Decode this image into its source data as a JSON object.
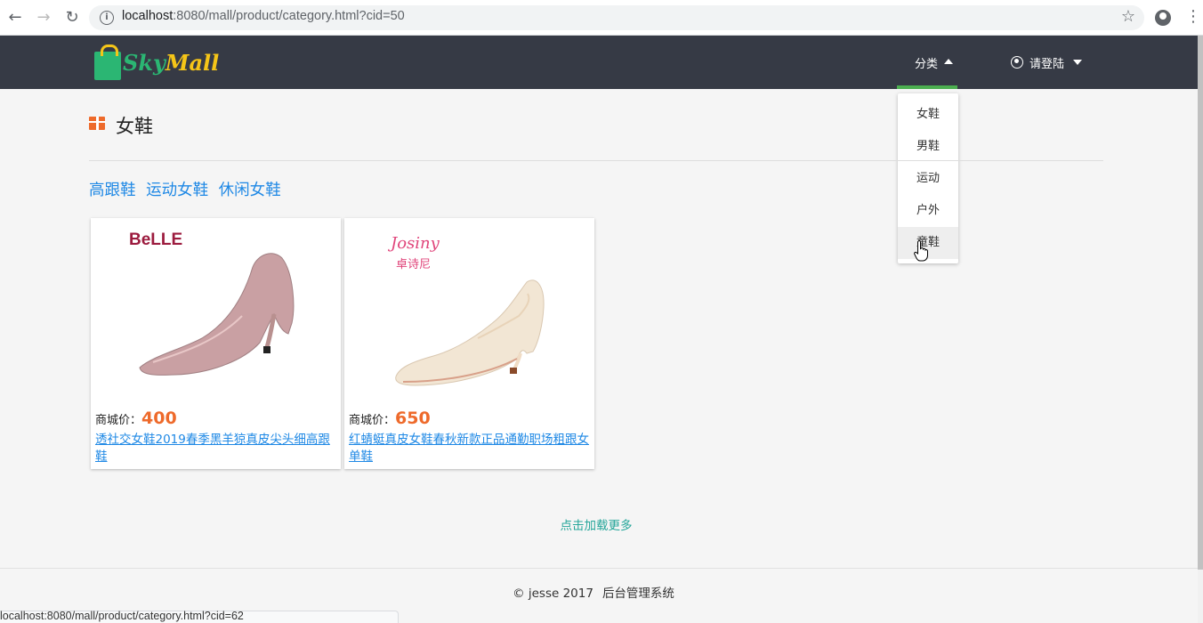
{
  "browser": {
    "url_host": "localhost",
    "url_rest": ":8080/mall/product/category.html?cid=50",
    "status_url": "localhost:8080/mall/product/category.html?cid=62"
  },
  "navbar": {
    "logo_sky": "Sky",
    "logo_mall": "Mall",
    "category_label": "分类",
    "login_label": "请登陆",
    "bg_color": "#363a45",
    "accent_color": "#4caf50"
  },
  "dropdown": {
    "items": [
      {
        "label": "女鞋"
      },
      {
        "label": "男鞋"
      },
      {
        "label": "运动"
      },
      {
        "label": "户外"
      },
      {
        "label": "童鞋"
      }
    ]
  },
  "page": {
    "title": "女鞋",
    "subcategories": [
      "高跟鞋",
      "运动女鞋",
      "休闲女鞋"
    ]
  },
  "products": [
    {
      "brand": "BeLLE",
      "price_label": "商城价：",
      "price": "400",
      "name": "透社交女鞋2019春季黑羊猄真皮尖头细高跟鞋"
    },
    {
      "brand": "Josiny",
      "brand_cn": "卓诗尼",
      "price_label": "商城价：",
      "price": "650",
      "name": "红蜻蜓真皮女鞋春秋新款正品通勤职场粗跟女单鞋"
    }
  ],
  "load_more": "点击加载更多",
  "footer": {
    "copyright": "© jesse 2017",
    "admin_link": "后台管理系统"
  }
}
